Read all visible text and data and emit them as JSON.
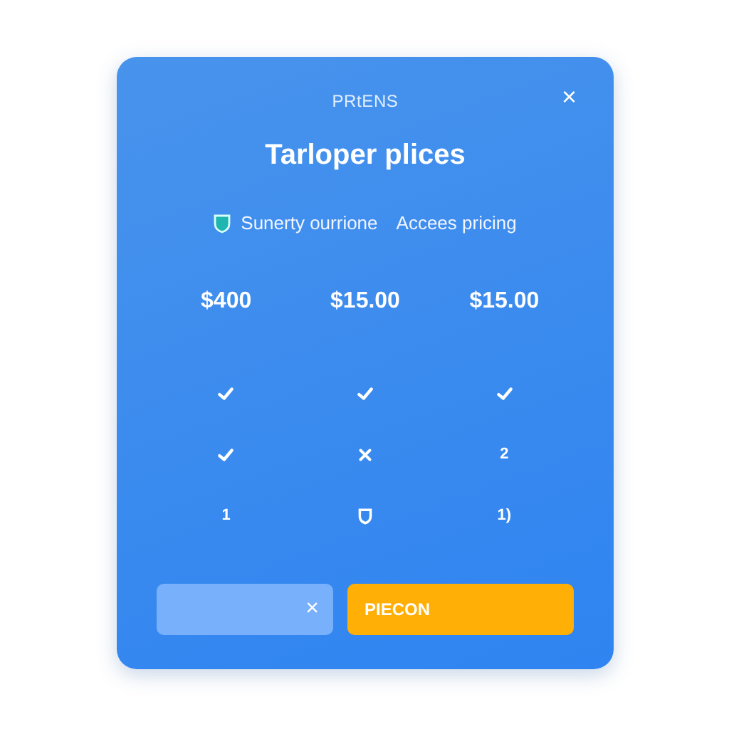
{
  "dialog": {
    "eyebrow": "PRtENS",
    "close": "×",
    "title": "Tarloper plices",
    "tagline": {
      "text": "Sunerty ourrione",
      "link": "Accees pricing"
    }
  },
  "prices": [
    "$400",
    "$15.00",
    "$15.00"
  ],
  "rows": [
    [
      {
        "kind": "check"
      },
      {
        "kind": "check"
      },
      {
        "kind": "check"
      }
    ],
    [
      {
        "kind": "check"
      },
      {
        "kind": "cross"
      },
      {
        "kind": "text",
        "text": "2"
      }
    ],
    [
      {
        "kind": "text",
        "text": "1"
      },
      {
        "kind": "shield"
      },
      {
        "kind": "text",
        "text": "1)"
      }
    ]
  ],
  "footer": {
    "secondary": "×",
    "primary": "PIECON"
  }
}
